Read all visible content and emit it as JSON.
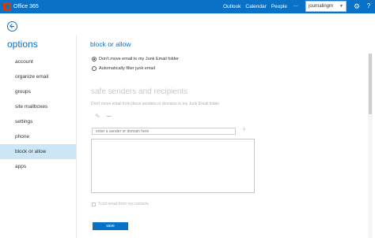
{
  "header": {
    "brand": "Office 365",
    "nav": [
      "Outlook",
      "Calendar",
      "People"
    ],
    "more": "...",
    "user": "journalingm",
    "gear_icon": "gear-icon",
    "help_icon": "help-icon",
    "help_symbol": "?",
    "accent_color": "#0a72c6"
  },
  "sidebar": {
    "title": "options",
    "items": [
      {
        "label": "account",
        "active": false
      },
      {
        "label": "organize email",
        "active": false
      },
      {
        "label": "groups",
        "active": false
      },
      {
        "label": "site mailboxes",
        "active": false
      },
      {
        "label": "settings",
        "active": false
      },
      {
        "label": "phone",
        "active": false
      },
      {
        "label": "block or allow",
        "active": true
      },
      {
        "label": "apps",
        "active": false
      }
    ]
  },
  "main": {
    "title": "block or allow",
    "radio_options": [
      {
        "label": "Don't move email to my Junk Email folder",
        "checked": true
      },
      {
        "label": "Automatically filter junk email",
        "checked": false
      }
    ],
    "safe_senders": {
      "title": "safe senders and recipients",
      "description": "Don't move email from these senders or domains to my Junk Email folder.",
      "input_placeholder": "enter a sender or domain here",
      "trust_contacts_label": "Trust email from my contacts",
      "trust_contacts_checked": false
    },
    "save_label": "save"
  }
}
